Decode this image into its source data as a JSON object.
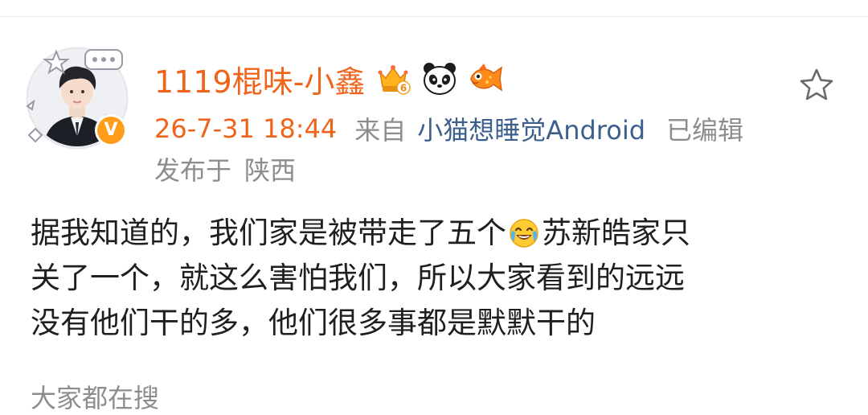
{
  "post": {
    "username": "1119棍味-小鑫",
    "time": "26-7-31 18:44",
    "from_label": "来自",
    "source": "小猫想睡觉Android",
    "edited": "已编辑",
    "location_prefix": "发布于",
    "location": "陕西",
    "body_line1_before": "据我知道的，我们家是被带走了五个",
    "body_line1_after": "苏新皓家只",
    "body_line2": "关了一个，就这么害怕我们，所以大家看到的远远",
    "body_line3": "没有他们干的多，他们很多事都是默默干的"
  },
  "hot_search_label": "大家都在搜",
  "colors": {
    "username": "#f0631b",
    "time": "#f0631b",
    "source_link": "#3d5f8e",
    "meta_gray": "#8d8d8d",
    "body_text": "#1f1f1f",
    "verified_badge": "#ff9c1a"
  },
  "icons": {
    "verified": "orange-v-verified-icon",
    "vip_badge": "crown-level-6-badge-icon",
    "panda": "panda-badge-icon",
    "fish": "fish-badge-icon",
    "favorite": "star-outline-icon",
    "emoji": "laugh-cry-emoji-icon"
  },
  "verified_mark": "V",
  "vip_level": "6"
}
